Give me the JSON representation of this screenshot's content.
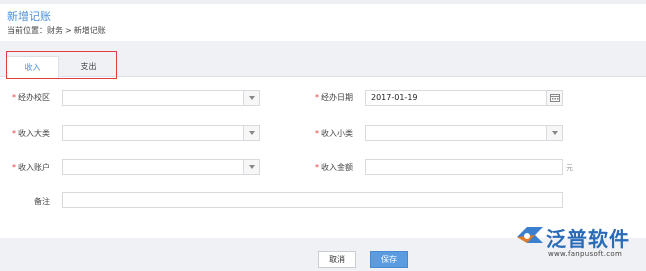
{
  "page": {
    "title": "新增记账",
    "breadcrumb_prefix": "当前位置：",
    "breadcrumb_finance": "财务",
    "breadcrumb_sep": ">",
    "breadcrumb_current": "新增记账"
  },
  "tabs": [
    {
      "label": "收入",
      "active": true
    },
    {
      "label": "支出",
      "active": false
    }
  ],
  "form": {
    "required_mark": "*",
    "campus": {
      "label": "经办校区",
      "value": ""
    },
    "date": {
      "label": "经办日期",
      "value": "2017-01-19"
    },
    "income_category": {
      "label": "收入大类",
      "value": ""
    },
    "income_subcategory": {
      "label": "收入小类",
      "value": ""
    },
    "income_account": {
      "label": "收入账户",
      "value": ""
    },
    "income_amount": {
      "label": "收入金额",
      "value": "",
      "unit": "元"
    },
    "remarks": {
      "label": "备注",
      "value": ""
    }
  },
  "actions": {
    "cancel_label": "取消",
    "save_label": "保存"
  },
  "branding": {
    "logo_text": "泛普软件",
    "logo_url": "www.fanpusoft.com"
  },
  "colors": {
    "accent": "#4a90d9",
    "required": "#e23c3c",
    "save_button": "#5b9be0",
    "logo": "#2a6bb8"
  }
}
